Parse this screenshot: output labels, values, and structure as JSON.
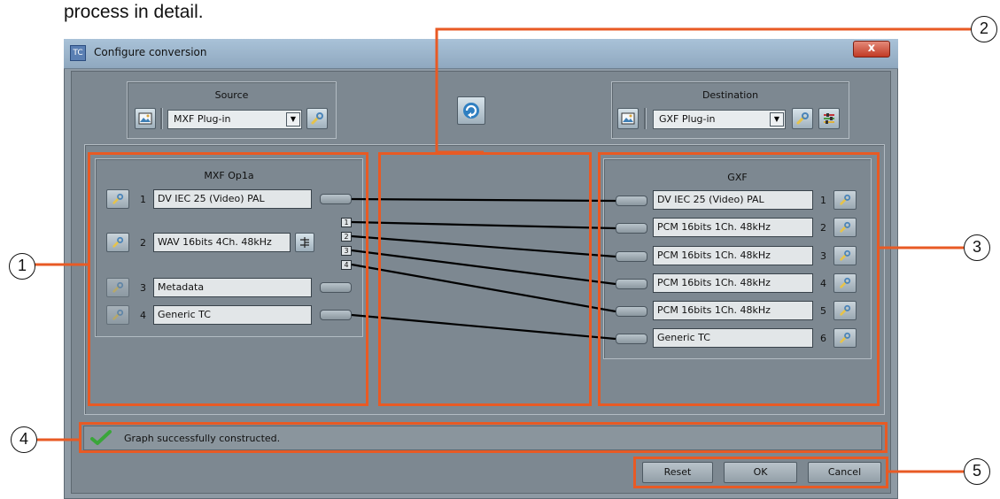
{
  "intro_text": "process in detail.",
  "window": {
    "title": "Configure conversion",
    "close_label": "x",
    "app_icon": "app-icon"
  },
  "source": {
    "group_title": "Source",
    "plugin_value": "MXF Plug-in"
  },
  "destination": {
    "group_title": "Destination",
    "plugin_value": "GXF Plug-in"
  },
  "source_tracks": {
    "title": "MXF Op1a",
    "items": [
      {
        "index": "1",
        "name": "DV IEC 25 (Video) PAL"
      },
      {
        "index": "2",
        "name": "WAV 16bits 4Ch. 48kHz"
      },
      {
        "index": "3",
        "name": "Metadata"
      },
      {
        "index": "4",
        "name": "Generic TC"
      }
    ],
    "sub_pins": [
      "1",
      "2",
      "3",
      "4"
    ]
  },
  "dest_tracks": {
    "title": "GXF",
    "items": [
      {
        "index": "1",
        "name": "DV IEC 25 (Video) PAL"
      },
      {
        "index": "2",
        "name": "PCM 16bits 1Ch. 48kHz"
      },
      {
        "index": "3",
        "name": "PCM 16bits 1Ch. 48kHz"
      },
      {
        "index": "4",
        "name": "PCM 16bits 1Ch. 48kHz"
      },
      {
        "index": "5",
        "name": "PCM 16bits 1Ch. 48kHz"
      },
      {
        "index": "6",
        "name": "Generic TC"
      }
    ]
  },
  "status": {
    "message": "Graph successfully constructed.",
    "icon": "checkmark-icon"
  },
  "buttons": {
    "reset": "Reset",
    "ok": "OK",
    "cancel": "Cancel"
  },
  "callouts": [
    "1",
    "2",
    "3",
    "4",
    "5"
  ],
  "colors": {
    "highlight": "#e85a24",
    "window_bg": "#8e9aa4",
    "status_ok": "#3aa63a"
  }
}
